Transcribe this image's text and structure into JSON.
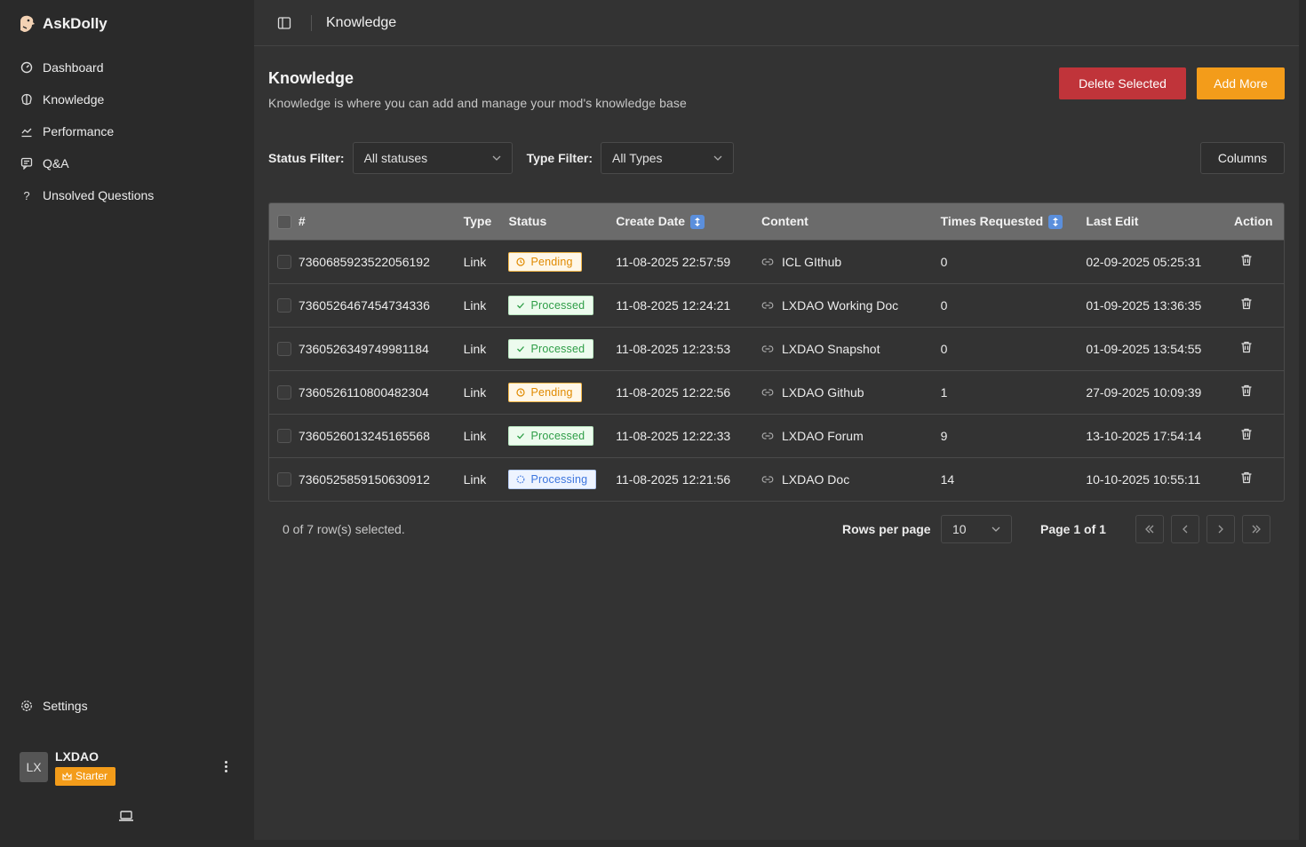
{
  "brand": {
    "name": "AskDolly"
  },
  "sidebar": {
    "items": [
      {
        "label": "Dashboard",
        "icon": "dashboard-icon"
      },
      {
        "label": "Knowledge",
        "icon": "brain-icon"
      },
      {
        "label": "Performance",
        "icon": "chart-line-icon"
      },
      {
        "label": "Q&A",
        "icon": "chat-icon"
      },
      {
        "label": "Unsolved Questions",
        "icon": "question-icon"
      }
    ],
    "settings": "Settings"
  },
  "user": {
    "initials": "LX",
    "name": "LXDAO",
    "plan": "Starter"
  },
  "topbar": {
    "breadcrumb": "Knowledge"
  },
  "page": {
    "title": "Knowledge",
    "subtitle": "Knowledge is where you can add and manage your mod's knowledge base",
    "delete_label": "Delete Selected",
    "add_label": "Add More"
  },
  "filters": {
    "status_label": "Status Filter:",
    "status_value": "All statuses",
    "type_label": "Type Filter:",
    "type_value": "All Types",
    "columns_label": "Columns"
  },
  "table": {
    "headers": [
      "#",
      "Type",
      "Status",
      "Create Date",
      "Content",
      "Times Requested",
      "Last Edit",
      "Action"
    ],
    "rows": [
      {
        "id": "7360685923522056192",
        "type": "Link",
        "status": "Pending",
        "status_kind": "pending",
        "created": "11-08-2025 22:57:59",
        "content": "ICL GIthub",
        "requested": "0",
        "last_edit": "02-09-2025 05:25:31"
      },
      {
        "id": "7360526467454734336",
        "type": "Link",
        "status": "Processed",
        "status_kind": "processed",
        "created": "11-08-2025 12:24:21",
        "content": "LXDAO Working Doc",
        "requested": "0",
        "last_edit": "01-09-2025 13:36:35"
      },
      {
        "id": "7360526349749981184",
        "type": "Link",
        "status": "Processed",
        "status_kind": "processed",
        "created": "11-08-2025 12:23:53",
        "content": "LXDAO Snapshot",
        "requested": "0",
        "last_edit": "01-09-2025 13:54:55"
      },
      {
        "id": "7360526110800482304",
        "type": "Link",
        "status": "Pending",
        "status_kind": "pending",
        "created": "11-08-2025 12:22:56",
        "content": "LXDAO Github",
        "requested": "1",
        "last_edit": "27-09-2025 10:09:39"
      },
      {
        "id": "7360526013245165568",
        "type": "Link",
        "status": "Processed",
        "status_kind": "processed",
        "created": "11-08-2025 12:22:33",
        "content": "LXDAO Forum",
        "requested": "9",
        "last_edit": "13-10-2025 17:54:14"
      },
      {
        "id": "7360525859150630912",
        "type": "Link",
        "status": "Processing",
        "status_kind": "processing",
        "created": "11-08-2025 12:21:56",
        "content": "LXDAO Doc",
        "requested": "14",
        "last_edit": "10-10-2025 10:55:11"
      }
    ]
  },
  "footer": {
    "selected": "0 of 7 row(s) selected.",
    "rows_per_page_label": "Rows per page",
    "rows_per_page_value": "10",
    "page_label": "Page 1 of 1"
  },
  "colors": {
    "accent": "#f39c1a",
    "danger": "#c0343a",
    "sort": "#5b8fdc"
  }
}
